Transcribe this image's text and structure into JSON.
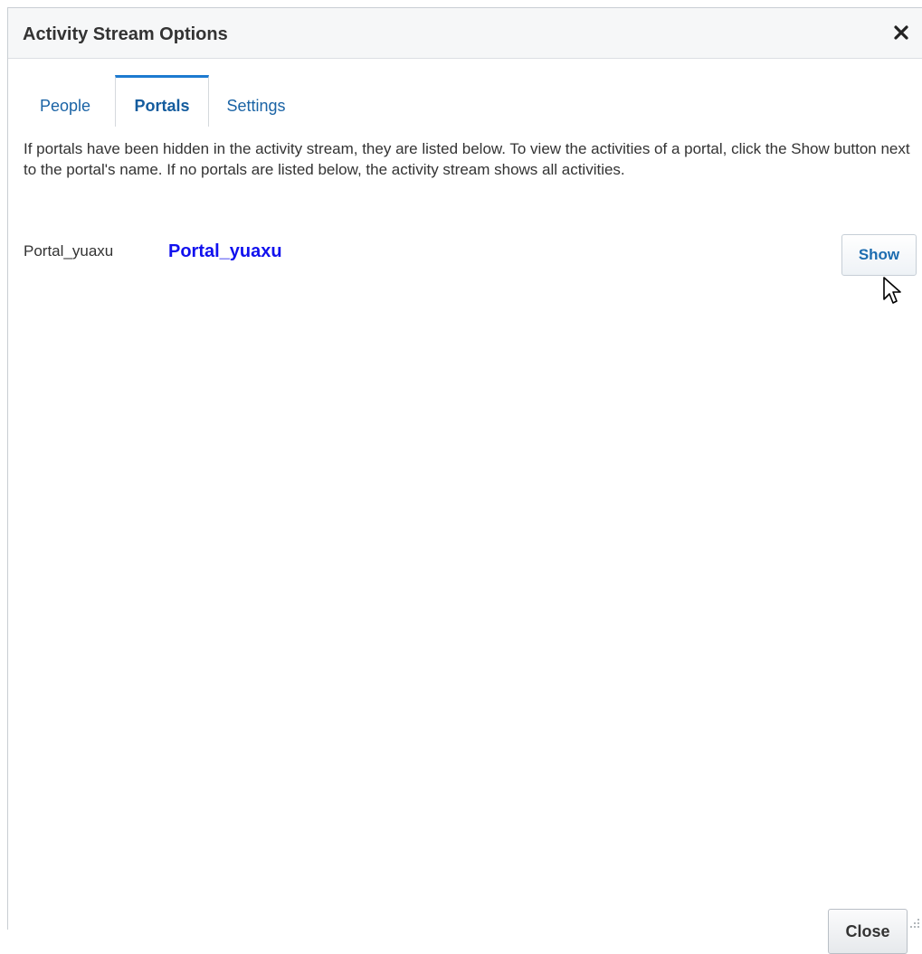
{
  "dialog": {
    "title": "Activity Stream Options",
    "close_icon": "close-x-icon"
  },
  "tabs": [
    {
      "label": "People",
      "active": false
    },
    {
      "label": "Portals",
      "active": true
    },
    {
      "label": "Settings",
      "active": false
    }
  ],
  "description": "If portals have been hidden in the activity stream, they are listed below. To view the activities of a portal, click the Show button next to the portal's name. If no portals are listed below, the activity stream shows all activities.",
  "portals": [
    {
      "id": "Portal_yuaxu",
      "name": "Portal_yuaxu",
      "action_label": "Show"
    }
  ],
  "footer": {
    "close_label": "Close"
  },
  "colors": {
    "link": "#1111ee",
    "tab_text": "#1a63a5",
    "active_tab_border": "#1d7ad0",
    "button_text": "#1c6cb0"
  }
}
